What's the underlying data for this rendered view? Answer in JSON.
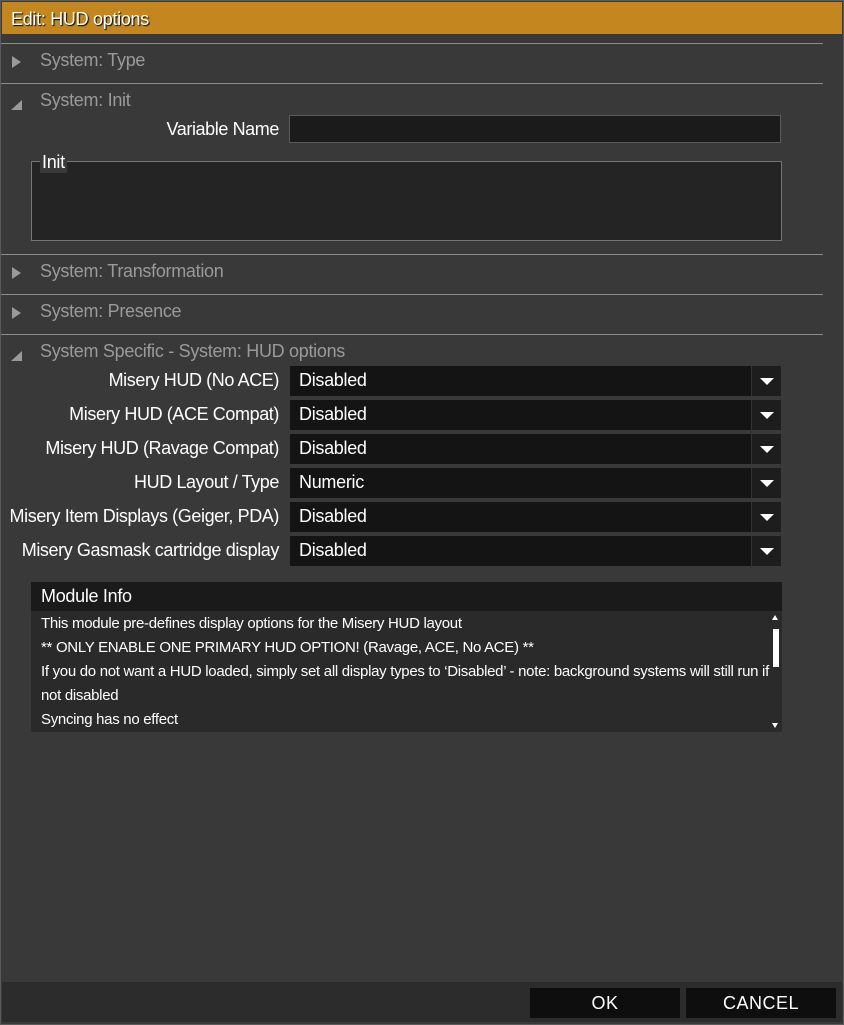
{
  "window": {
    "title": "Edit: HUD options"
  },
  "sections": {
    "type": {
      "label": "System: Type",
      "expanded": false
    },
    "init": {
      "label": "System: Init",
      "expanded": true
    },
    "transformation": {
      "label": "System: Transformation",
      "expanded": false
    },
    "presence": {
      "label": "System: Presence",
      "expanded": false
    },
    "hud": {
      "label": "System Specific - System: HUD options",
      "expanded": true
    }
  },
  "init": {
    "variable_name_label": "Variable Name",
    "variable_name_value": "",
    "init_label": "Init",
    "init_value": ""
  },
  "hud_options": [
    {
      "label": "Misery HUD (No ACE)",
      "value": "Disabled"
    },
    {
      "label": "Misery HUD (ACE Compat)",
      "value": "Disabled"
    },
    {
      "label": "Misery HUD (Ravage Compat)",
      "value": "Disabled"
    },
    {
      "label": "HUD Layout / Type",
      "value": "Numeric"
    },
    {
      "label": "Misery Item Displays (Geiger, PDA)",
      "value": "Disabled"
    },
    {
      "label": "Misery Gasmask cartridge display",
      "value": "Disabled"
    }
  ],
  "module_info": {
    "title": "Module Info",
    "lines": [
      "This module pre-defines display options for the Misery HUD layout",
      "** ONLY ENABLE ONE PRIMARY HUD OPTION! (Ravage, ACE, No ACE) **",
      "If you do not want a HUD loaded, simply set all display types to ‘Disabled’ - note: background systems will still run if not disabled",
      "Syncing has no effect"
    ]
  },
  "footer": {
    "ok_label": "OK",
    "cancel_label": "CANCEL"
  },
  "colors": {
    "title_bar": "#c4861e",
    "panel": "#393939",
    "field": "#141414"
  }
}
